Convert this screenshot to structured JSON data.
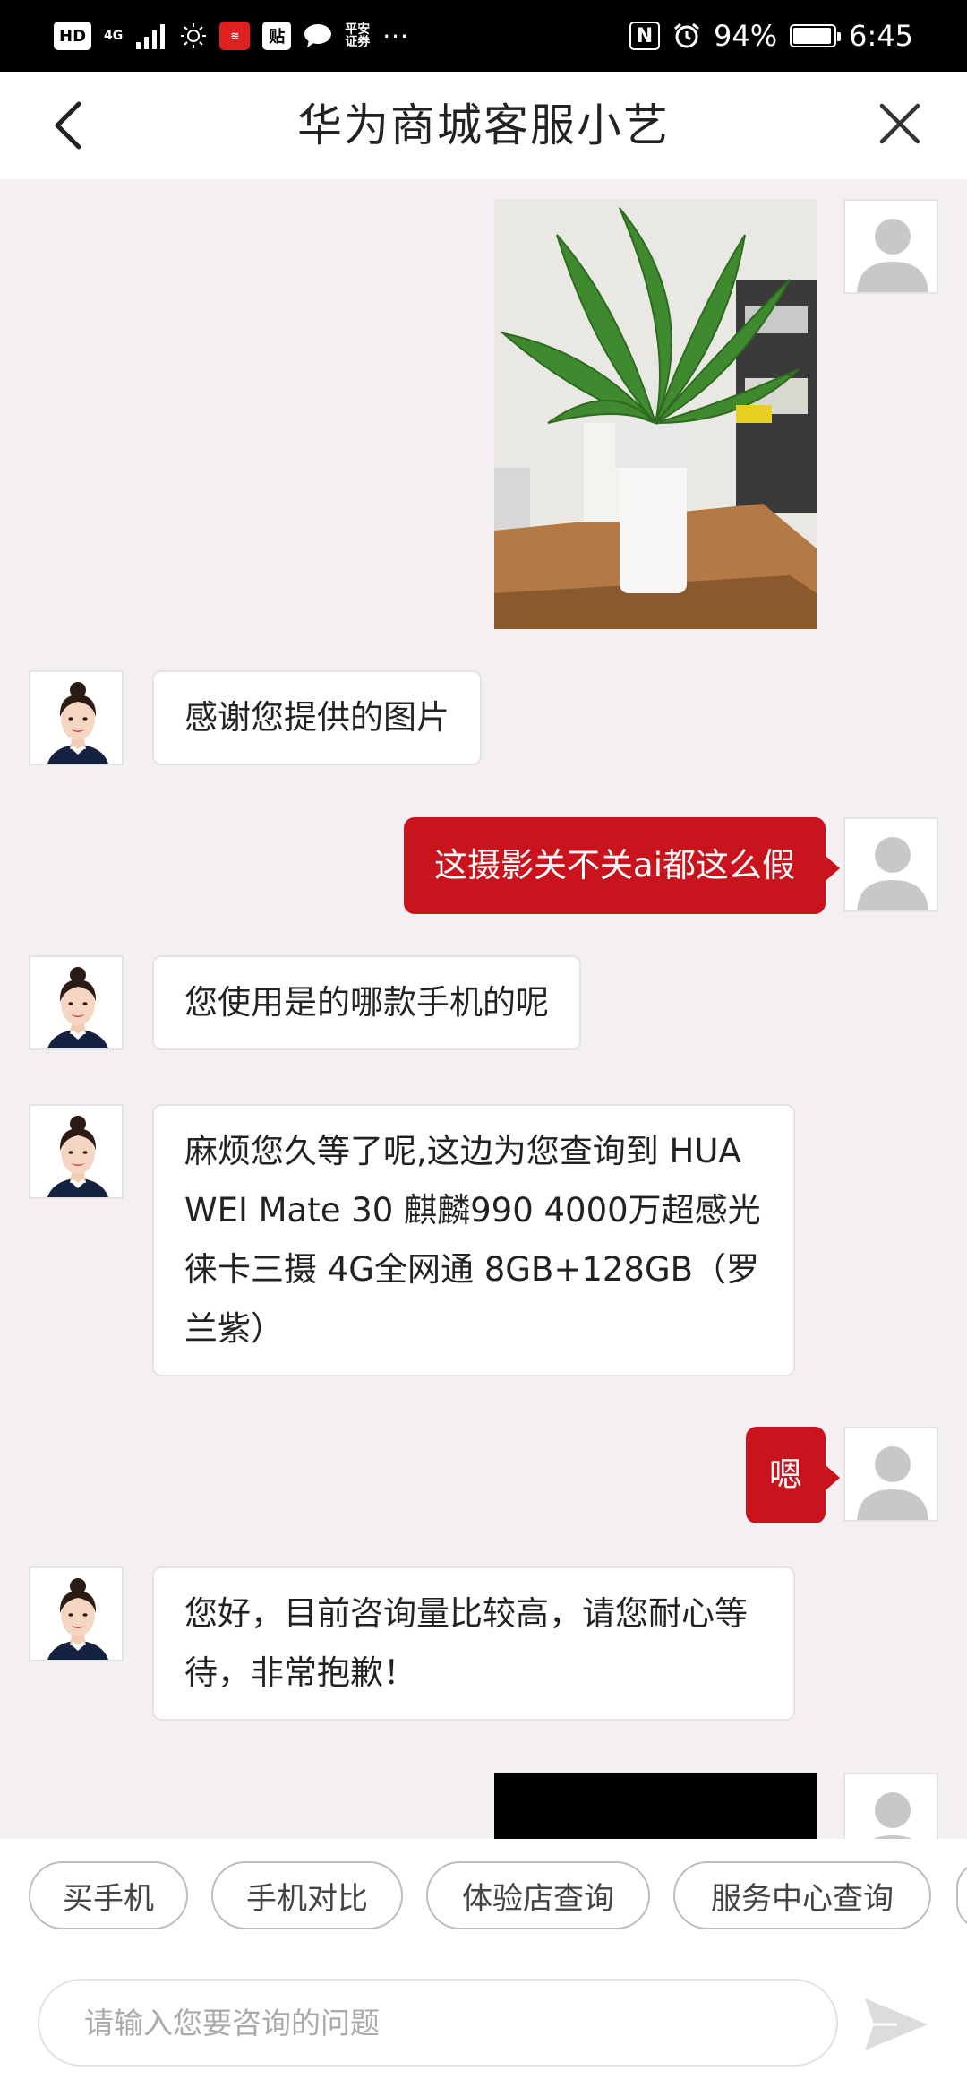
{
  "status_bar": {
    "hd": "HD",
    "net": "4G",
    "tie": "贴",
    "pingan_line1": "平安",
    "pingan_line2": "证券",
    "more": "···",
    "nfc": "N",
    "battery_text": "94%",
    "battery_level": 0.94,
    "time": "6:45"
  },
  "header": {
    "title": "华为商城客服小艺"
  },
  "messages": [
    {
      "from": "user",
      "type": "image",
      "description": "plant-photo"
    },
    {
      "from": "agent",
      "text": "感谢您提供的图片"
    },
    {
      "from": "user",
      "text": "这摄影关不关ai都这么假"
    },
    {
      "from": "agent",
      "text": "您使用是的哪款手机的呢"
    },
    {
      "from": "agent",
      "text": "麻烦您久等了呢,这边为您查询到 HUAWEI Mate 30 麒麟990 4000万超感光徕卡三摄 4G全网通 8GB+128GB（罗兰紫）"
    },
    {
      "from": "user",
      "text": "嗯"
    },
    {
      "from": "agent",
      "text": "您好，目前咨询量比较高，请您耐心等待，非常抱歉！"
    },
    {
      "from": "user",
      "type": "image",
      "description": "black-image"
    }
  ],
  "quick_replies": [
    "买手机",
    "手机对比",
    "体验店查询",
    "服务中心查询"
  ],
  "input": {
    "placeholder": "请输入您要咨询的问题",
    "value": ""
  },
  "colors": {
    "accent_red": "#c9141d",
    "chat_bg": "#f4eff3"
  }
}
